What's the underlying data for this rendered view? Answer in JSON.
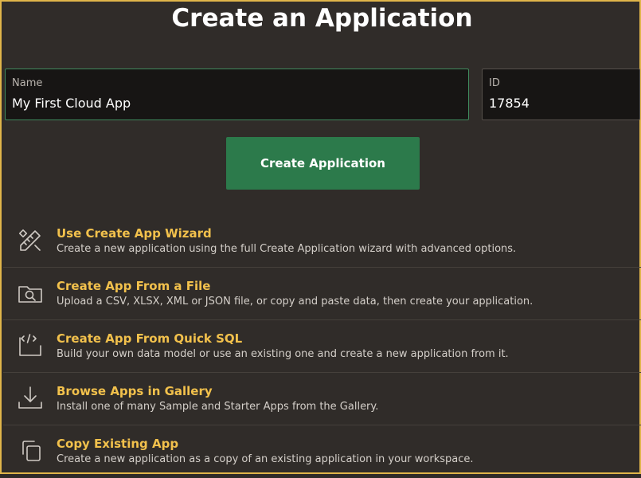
{
  "page": {
    "title": "Create an Application"
  },
  "form": {
    "name": {
      "label": "Name",
      "value": "My First Cloud App"
    },
    "id": {
      "label": "ID",
      "value": "17854"
    },
    "create_button_label": "Create Application"
  },
  "options": [
    {
      "icon": "wizard-icon",
      "title": "Use Create App Wizard",
      "description": "Create a new application using the full Create Application wizard with advanced options."
    },
    {
      "icon": "folder-search-icon",
      "title": "Create App From a File",
      "description": "Upload a CSV, XLSX, XML or JSON file, or copy and paste data, then create your application."
    },
    {
      "icon": "code-icon",
      "title": "Create App From Quick SQL",
      "description": "Build your own data model or use an existing one and create a new application from it."
    },
    {
      "icon": "download-icon",
      "title": "Browse Apps in Gallery",
      "description": "Install one of many Sample and Starter Apps from the Gallery."
    },
    {
      "icon": "copy-icon",
      "title": "Copy Existing App",
      "description": "Create a new application as a copy of an existing application in your workspace."
    }
  ],
  "colors": {
    "background": "#302c29",
    "frame_border": "#e0b54a",
    "accent_title": "#f2c14c",
    "primary_button": "#2c7a4b"
  }
}
